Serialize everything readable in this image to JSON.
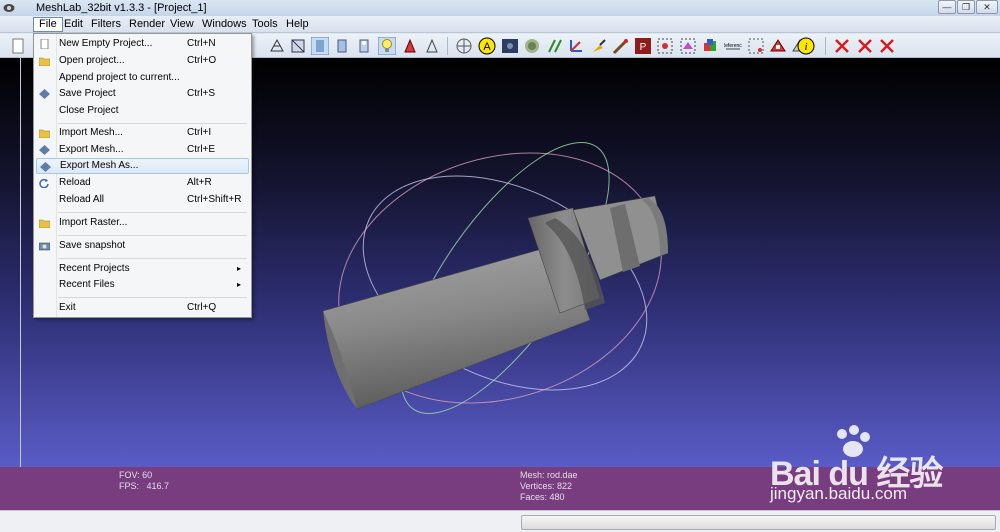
{
  "window": {
    "title": "MeshLab_32bit v1.3.3 - [Project_1]",
    "controls": [
      "—",
      "❐",
      "✕"
    ]
  },
  "menubar": {
    "items": [
      "File",
      "Edit",
      "Filters",
      "Render",
      "View",
      "Windows",
      "Tools",
      "Help"
    ],
    "active": "File"
  },
  "file_menu": {
    "items": [
      {
        "label": "New Empty Project...",
        "shortcut": "Ctrl+N",
        "icon": "new-document-icon"
      },
      {
        "label": "Open project...",
        "shortcut": "Ctrl+O",
        "icon": "open-folder-icon"
      },
      {
        "label": "Append project to current...",
        "shortcut": "",
        "icon": ""
      },
      {
        "label": "Save Project",
        "shortcut": "Ctrl+S",
        "icon": "save-icon"
      },
      {
        "label": "Close Project",
        "shortcut": "",
        "icon": ""
      },
      {
        "label": "Import Mesh...",
        "shortcut": "Ctrl+I",
        "icon": "open-folder-icon"
      },
      {
        "label": "Export Mesh...",
        "shortcut": "Ctrl+E",
        "icon": "save-icon"
      },
      {
        "label": "Export Mesh As...",
        "shortcut": "",
        "icon": "save-icon"
      },
      {
        "label": "Reload",
        "shortcut": "Alt+R",
        "icon": "reload-icon"
      },
      {
        "label": "Reload All",
        "shortcut": "Ctrl+Shift+R",
        "icon": ""
      },
      {
        "label": "Import Raster...",
        "shortcut": "",
        "icon": "open-folder-icon"
      },
      {
        "label": "Save snapshot",
        "shortcut": "",
        "icon": "camera-icon"
      },
      {
        "label": "Recent Projects",
        "shortcut": "",
        "icon": ""
      },
      {
        "label": "Recent Files",
        "shortcut": "",
        "icon": ""
      },
      {
        "label": "Exit",
        "shortcut": "Ctrl+Q",
        "icon": ""
      }
    ],
    "highlighted": "Export Mesh As...",
    "submenu_arrow": "▸"
  },
  "viewport": {
    "fov": "FOV: 60",
    "fps": "FPS:   416.7",
    "mesh": "Mesh: rod.dae",
    "vertices": "Vertices: 822",
    "faces": "Faces: 480"
  },
  "watermark": {
    "logo": "Bai du 经验",
    "url": "jingyan.baidu.com"
  },
  "colors": {
    "info_bar": "#783d7f",
    "viewport_top": "#000000",
    "viewport_bottom": "#5a5cc7",
    "menu_highlight": "#dbe8f7"
  }
}
